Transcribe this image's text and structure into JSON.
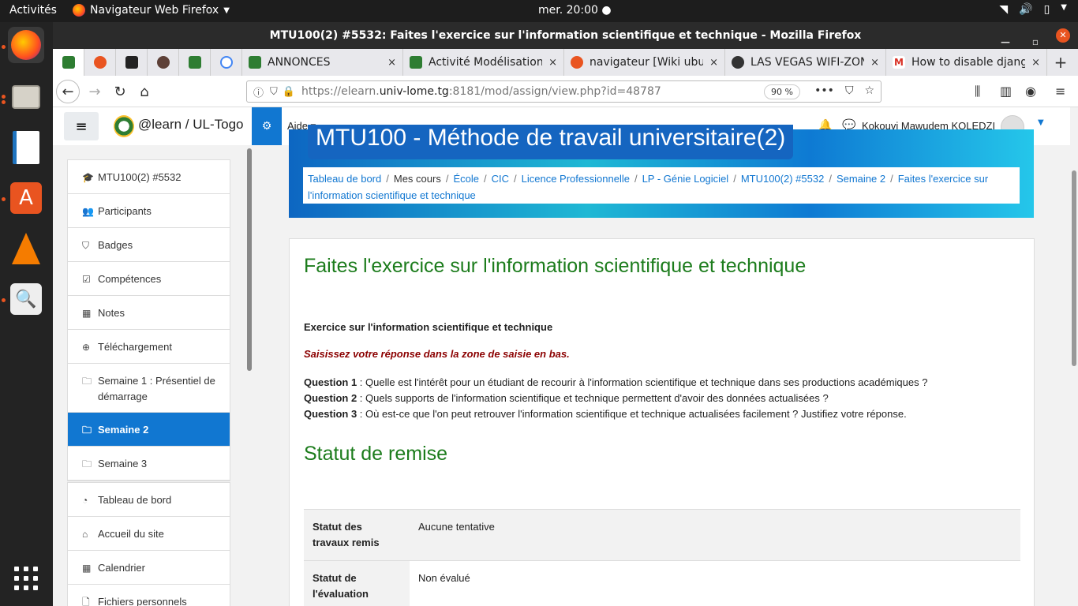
{
  "system": {
    "activities": "Activités",
    "app_name": "Navigateur Web Firefox",
    "clock": "mer. 20:00 ●"
  },
  "window": {
    "title": "MTU100(2) #5532: Faites l'exercice sur l'information scientifique et technique - Mozilla Firefox"
  },
  "tabs": [
    {
      "label": "ANNONCES"
    },
    {
      "label": "Activité Modélisation"
    },
    {
      "label": "navigateur [Wiki ubun"
    },
    {
      "label": "LAS VEGAS WIFI-ZONE"
    },
    {
      "label": "How to disable djang"
    }
  ],
  "tab_close": "×",
  "tab_new": "+",
  "urlbar": {
    "prefix": "https://elearn.",
    "domain": "univ-lome.tg",
    "suffix": ":8181/mod/assign/view.php?id=48787",
    "zoom": "90 %"
  },
  "header": {
    "brand": "@learn / UL-Togo",
    "help_menu": "Aide ▾",
    "user_name": "Kokouvi Mawudem KOLEDZI"
  },
  "drawer": {
    "group1": [
      {
        "icon": "🎓",
        "label": "MTU100(2) #5532"
      },
      {
        "icon": "👥",
        "label": "Participants"
      },
      {
        "icon": "⛉",
        "label": "Badges"
      },
      {
        "icon": "☑",
        "label": "Compétences"
      },
      {
        "icon": "▦",
        "label": "Notes"
      },
      {
        "icon": "⊕",
        "label": "Téléchargement"
      },
      {
        "icon": "🗀",
        "label": "Semaine 1 : Présentiel de démarrage"
      },
      {
        "icon": "🗀",
        "label": "Semaine 2"
      },
      {
        "icon": "🗀",
        "label": "Semaine 3"
      }
    ],
    "group2": [
      {
        "icon": "◔",
        "label": "Tableau de bord"
      },
      {
        "icon": "⌂",
        "label": "Accueil du site"
      },
      {
        "icon": "▦",
        "label": "Calendrier"
      },
      {
        "icon": "🗋",
        "label": "Fichiers personnels"
      }
    ]
  },
  "course": {
    "banner_title": "MTU100 - Méthode de travail universitaire(2)"
  },
  "breadcrumb": [
    {
      "label": "Tableau de bord",
      "link": true
    },
    {
      "label": "Mes cours",
      "link": false
    },
    {
      "label": "École",
      "link": true
    },
    {
      "label": "CIC",
      "link": true
    },
    {
      "label": "Licence Professionnelle",
      "link": true
    },
    {
      "label": "LP - Génie Logiciel",
      "link": true
    },
    {
      "label": "MTU100(2) #5532",
      "link": true
    },
    {
      "label": "Semaine 2",
      "link": true
    },
    {
      "label": "Faites l'exercice sur l'information scientifique et technique",
      "link": true
    }
  ],
  "assignment": {
    "title": "Faites l'exercice sur l'information scientifique et technique",
    "subtitle": "Exercice sur l'information scientifique et technique",
    "instruction": "Saisissez votre réponse dans la zone de saisie en bas.",
    "questions": [
      {
        "label": "Question 1",
        "text": " : Quelle est l'intérêt pour un étudiant de recourir à l'information scientifique et technique dans ses productions académiques ?"
      },
      {
        "label": "Question 2",
        "text": " : Quels supports de l'information scientifique et technique permettent d'avoir des données actualisées ?"
      },
      {
        "label": "Question 3",
        "text": " : Où est-ce que l'on peut retrouver l'information scientifique et technique actualisées facilement ? Justifiez votre réponse."
      }
    ],
    "status_heading": "Statut de remise",
    "status_rows": [
      {
        "label": "Statut des travaux remis",
        "value": "Aucune tentative"
      },
      {
        "label": "Statut de l'évaluation",
        "value": "Non évalué"
      }
    ]
  },
  "colors": {
    "accent": "#1177d1",
    "heading_green": "#1c7c1c",
    "instruction_red": "#8b0000",
    "ubuntu_orange": "#e95420"
  }
}
